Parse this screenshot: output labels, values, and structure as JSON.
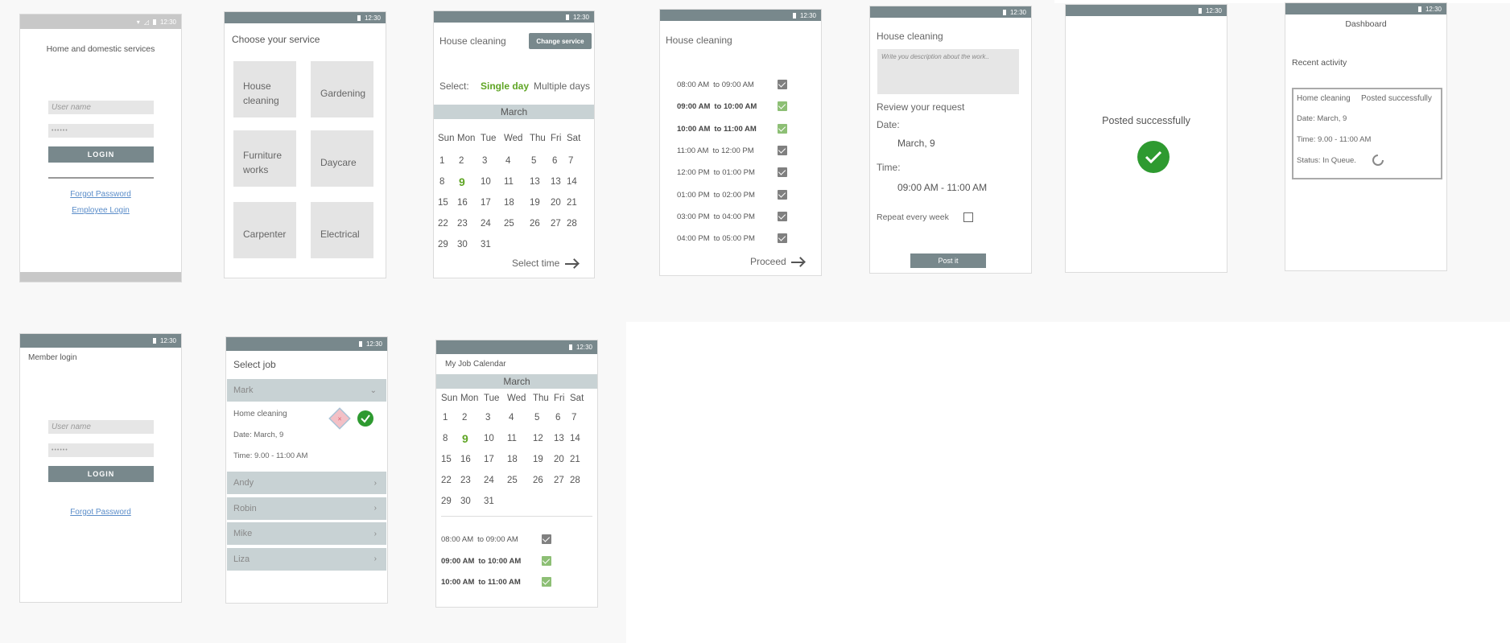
{
  "status_time": "12:30",
  "colors": {
    "accent_green": "#5fa524",
    "bar": "#78888c",
    "month_bar": "#c8d2d4",
    "success": "#2e9a30"
  },
  "login": {
    "title": "Home and domestic services",
    "username_placeholder": "User name",
    "password_mask": "••••••",
    "login_label": "LOGIN",
    "forgot": "Forgot Password",
    "employee": "Employee Login"
  },
  "choose": {
    "title": "Choose your service",
    "tiles": [
      "House cleaning",
      "Gardening",
      "Furniture works",
      "Daycare",
      "Carpenter",
      "Electrical"
    ]
  },
  "calendar": {
    "title": "House cleaning",
    "change_label": "Change service",
    "select_label": "Select:",
    "single": "Single day",
    "multiple": "Multiple days",
    "month": "March",
    "days": [
      "Sun",
      "Mon",
      "Tue",
      "Wed",
      "Thu",
      "Fri",
      "Sat"
    ],
    "weeks": [
      [
        "1",
        "2",
        "3",
        "4",
        "5",
        "6",
        "7"
      ],
      [
        "8",
        "9",
        "10",
        "11",
        "13",
        "13",
        "14"
      ],
      [
        "15",
        "16",
        "17",
        "18",
        "19",
        "20",
        "21"
      ],
      [
        "22",
        "23",
        "24",
        "25",
        "26",
        "27",
        "28"
      ],
      [
        "29",
        "30",
        "31"
      ]
    ],
    "next": "Select time"
  },
  "times": {
    "title": "House cleaning",
    "slots": [
      {
        "from": "08:00 AM",
        "to": "to 09:00 AM",
        "checked": false
      },
      {
        "from": "09:00 AM",
        "to": "to 10:00 AM",
        "checked": true
      },
      {
        "from": "10:00 AM",
        "to": "to 11:00 AM",
        "checked": true
      },
      {
        "from": "11:00 AM",
        "to": "to 12:00 PM",
        "checked": false
      },
      {
        "from": "12:00 PM",
        "to": "to 01:00 PM",
        "checked": false
      },
      {
        "from": "01:00 PM",
        "to": "to 02:00 PM",
        "checked": false
      },
      {
        "from": "03:00 PM",
        "to": "to 04:00 PM",
        "checked": false
      },
      {
        "from": "04:00 PM",
        "to": "to 05:00 PM",
        "checked": false
      }
    ],
    "proceed": "Proceed"
  },
  "review": {
    "title": "House cleaning",
    "desc_placeholder": "Write you description about the work..",
    "heading": "Review your request",
    "date_label": "Date:",
    "date_value": "March, 9",
    "time_label": "Time:",
    "time_value": "09:00 AM - 11:00 AM",
    "repeat": "Repeat every week",
    "post": "Post it"
  },
  "posted": {
    "message": "Posted successfully"
  },
  "dashboard": {
    "title": "Dashboard",
    "recent": "Recent activity",
    "card_service": "Home cleaning",
    "card_state": "Posted successfully",
    "card_date": "Date: March, 9",
    "card_time": "Time: 9.00 - 11:00 AM",
    "card_status": "Status: In Queue."
  },
  "member": {
    "title": "Member login",
    "username_placeholder": "User name",
    "password_mask": "••••••",
    "login_label": "LOGIN",
    "forgot": "Forgot Password"
  },
  "jobs": {
    "title": "Select job",
    "open_name": "Mark",
    "open_service": "Home cleaning",
    "open_date": "Date: March, 9",
    "open_time": "Time: 9.00 - 11:00 AM",
    "others": [
      "Andy",
      "Robin",
      "Mike",
      "Liza"
    ]
  },
  "jobcal": {
    "title": "My Job Calendar",
    "month": "March",
    "days": [
      "Sun",
      "Mon",
      "Tue",
      "Wed",
      "Thu",
      "Fri",
      "Sat"
    ],
    "weeks": [
      [
        "1",
        "2",
        "3",
        "4",
        "5",
        "6",
        "7"
      ],
      [
        "8",
        "9",
        "10",
        "11",
        "12",
        "13",
        "14"
      ],
      [
        "15",
        "16",
        "17",
        "18",
        "19",
        "20",
        "21"
      ],
      [
        "22",
        "23",
        "24",
        "25",
        "26",
        "27",
        "28"
      ],
      [
        "29",
        "30",
        "31"
      ]
    ],
    "slots": [
      {
        "from": "08:00 AM",
        "to": "to 09:00 AM",
        "checked": false
      },
      {
        "from": "09:00 AM",
        "to": "to 10:00 AM",
        "checked": true
      },
      {
        "from": "10:00 AM",
        "to": "to 11:00 AM",
        "checked": true
      }
    ]
  }
}
